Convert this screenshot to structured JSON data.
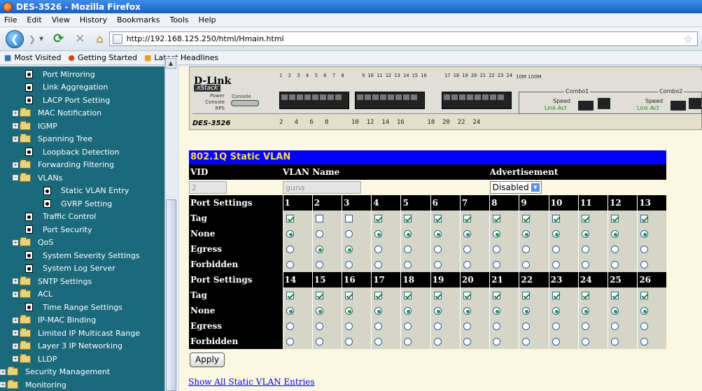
{
  "window": {
    "title": "DES-3526 - Mozilla Firefox"
  },
  "menu": [
    "File",
    "Edit",
    "View",
    "History",
    "Bookmarks",
    "Tools",
    "Help"
  ],
  "url": "http://192.168.125.250/html/Hmain.html",
  "bookmarks": [
    "Most Visited",
    "Getting Started",
    "Latest Headlines"
  ],
  "sidebar": {
    "items": [
      {
        "label": "Port Mirroring",
        "type": "doc",
        "indent": 1
      },
      {
        "label": "Link Aggregation",
        "type": "doc",
        "indent": 1
      },
      {
        "label": "LACP Port Setting",
        "type": "doc",
        "indent": 1
      },
      {
        "label": "MAC Notification",
        "type": "folder",
        "indent": 1
      },
      {
        "label": "IGMP",
        "type": "folder",
        "indent": 1
      },
      {
        "label": "Spanning Tree",
        "type": "folder",
        "indent": 1
      },
      {
        "label": "Loopback Detection",
        "type": "doc",
        "indent": 1
      },
      {
        "label": "Forwarding Filtering",
        "type": "folder",
        "indent": 1
      },
      {
        "label": "VLANs",
        "type": "folder-open",
        "indent": 1
      },
      {
        "label": "Static VLAN Entry",
        "type": "doc",
        "indent": 2
      },
      {
        "label": "GVRP Setting",
        "type": "doc",
        "indent": 2
      },
      {
        "label": "Traffic Control",
        "type": "doc",
        "indent": 1
      },
      {
        "label": "Port Security",
        "type": "doc",
        "indent": 1
      },
      {
        "label": "QoS",
        "type": "folder",
        "indent": 1
      },
      {
        "label": "System Severity Settings",
        "type": "doc",
        "indent": 1
      },
      {
        "label": "System Log Server",
        "type": "doc",
        "indent": 1
      },
      {
        "label": "SNTP Settings",
        "type": "folder",
        "indent": 1
      },
      {
        "label": "ACL",
        "type": "folder",
        "indent": 1
      },
      {
        "label": "Time Range Settings",
        "type": "doc",
        "indent": 1
      },
      {
        "label": "IP-MAC Binding",
        "type": "folder",
        "indent": 1
      },
      {
        "label": "Limited IP Multicast Range",
        "type": "folder",
        "indent": 1
      },
      {
        "label": "Layer 3 IP Networking",
        "type": "folder",
        "indent": 1
      },
      {
        "label": "LLDP",
        "type": "folder",
        "indent": 1
      },
      {
        "label": "Security Management",
        "type": "folder",
        "indent": 0
      },
      {
        "label": "Monitoring",
        "type": "folder",
        "indent": 0
      }
    ]
  },
  "device": {
    "brand": "D-Link",
    "stack": "xStack",
    "model": "DES-3526",
    "led_labels": "Power\nConsole\nRPS",
    "console": "Console",
    "top_port_numbers": "1  2  3  4  5  6  7  8      9 10 11 12 13 14 15 16      17 18 19 20 21 22 23 24",
    "bottom_port_numbers": "2   4   6   8      10  12  14  16      18  20  22  24",
    "speed_legend": "10M  100M",
    "combo1": "Combo1",
    "combo2": "Combo2",
    "speed": "Speed",
    "link_act": "Link  Act"
  },
  "form": {
    "title": "802.1Q Static VLAN",
    "col_vid": "VID",
    "col_vlan_name": "VLAN Name",
    "col_advertisement": "Advertisement",
    "vid_value": "2",
    "vlan_name_value": "guna",
    "advertisement_value": "Disabled",
    "port_settings": "Port Settings",
    "row_tag": "Tag",
    "row_none": "None",
    "row_egress": "Egress",
    "row_forbidden": "Forbidden",
    "apply": "Apply",
    "show_all": "Show All Static VLAN Entries"
  },
  "ports_group1": {
    "ports": [
      "1",
      "2",
      "3",
      "4",
      "5",
      "6",
      "7",
      "8",
      "9",
      "10",
      "11",
      "12",
      "13"
    ],
    "tag": [
      true,
      false,
      false,
      true,
      true,
      true,
      true,
      true,
      true,
      true,
      true,
      true,
      true
    ],
    "mode": [
      "none",
      "egress",
      "egress",
      "none",
      "none",
      "none",
      "none",
      "none",
      "none",
      "none",
      "none",
      "none",
      "none"
    ]
  },
  "ports_group2": {
    "ports": [
      "14",
      "15",
      "16",
      "17",
      "18",
      "19",
      "20",
      "21",
      "22",
      "23",
      "24",
      "25",
      "26"
    ],
    "tag": [
      true,
      true,
      true,
      true,
      true,
      true,
      true,
      true,
      true,
      true,
      true,
      true,
      true
    ],
    "mode": [
      "none",
      "none",
      "none",
      "none",
      "none",
      "none",
      "none",
      "none",
      "none",
      "none",
      "none",
      "none",
      "none"
    ]
  },
  "colors": {
    "sidebar_bg": "#1a6a7c",
    "title_bar": "#0000ff",
    "title_text": "#ffdc4a",
    "content_bg": "#fbf7e0"
  }
}
